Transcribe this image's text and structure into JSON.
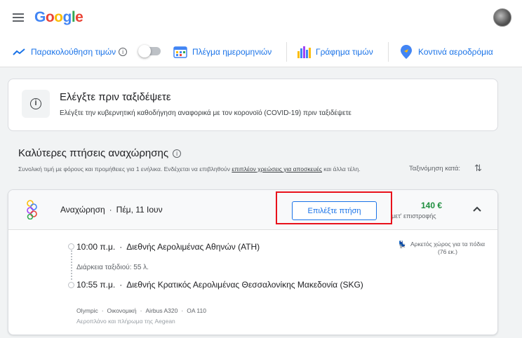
{
  "header": {
    "logo_letters": [
      "G",
      "o",
      "o",
      "g",
      "l",
      "e"
    ]
  },
  "toolbar": {
    "track_prices": "Παρακολούθηση τιμών",
    "date_grid": "Πλέγμα ημερομηνιών",
    "price_graph": "Γράφημα τιμών",
    "nearby_airports": "Κοντινά αεροδρόμια",
    "track_toggle_on": false
  },
  "covid_notice": {
    "title": "Ελέγξτε πριν ταξιδέψετε",
    "subtitle": "Ελέγξτε την κυβερνητική καθοδήγηση αναφορικά με τον κορονοϊό (COVID-19) πριν ταξιδέψετε"
  },
  "results": {
    "title": "Καλύτερες πτήσεις αναχώρησης",
    "note_before": "Συνολική τιμή με φόρους και προμήθειες για 1 ενήλικα. Ενδέχεται να επιβληθούν ",
    "note_link": "επιπλέον χρεώσεις για αποσκευές",
    "note_after": " και άλλα τέλη.",
    "sort_label": "Ταξινόμηση κατά:"
  },
  "flight": {
    "departure_label": "Αναχώρηση",
    "date": "Πέμ, 11 Ιουν",
    "select_button": "Επιλέξτε πτήση",
    "price": "140 €",
    "price_note": "μετ' επιστροφής",
    "departure_time": "10:00 π.μ.",
    "departure_airport": "Διεθνής Αερολιμένας Αθηνών (ATH)",
    "duration": "Διάρκεια ταξιδιού: 55 λ.",
    "arrival_time": "10:55 π.μ.",
    "arrival_airport": "Διεθνής Κρατικός Αερολιμένας Θεσσαλονίκης Μακεδονία (SKG)",
    "airline": "Olympic",
    "cabin": "Οικονομική",
    "aircraft": "Airbus A320",
    "flight_number": "OA 110",
    "operated_by": "Αεροπλάνο και πλήρωμα της Aegean",
    "legroom": "Αρκετός χώρος για τα πόδια (76 εκ.)"
  },
  "colors": {
    "accent": "#1a73e8",
    "price": "#1e8e3e",
    "highlight": "#e8111b"
  }
}
